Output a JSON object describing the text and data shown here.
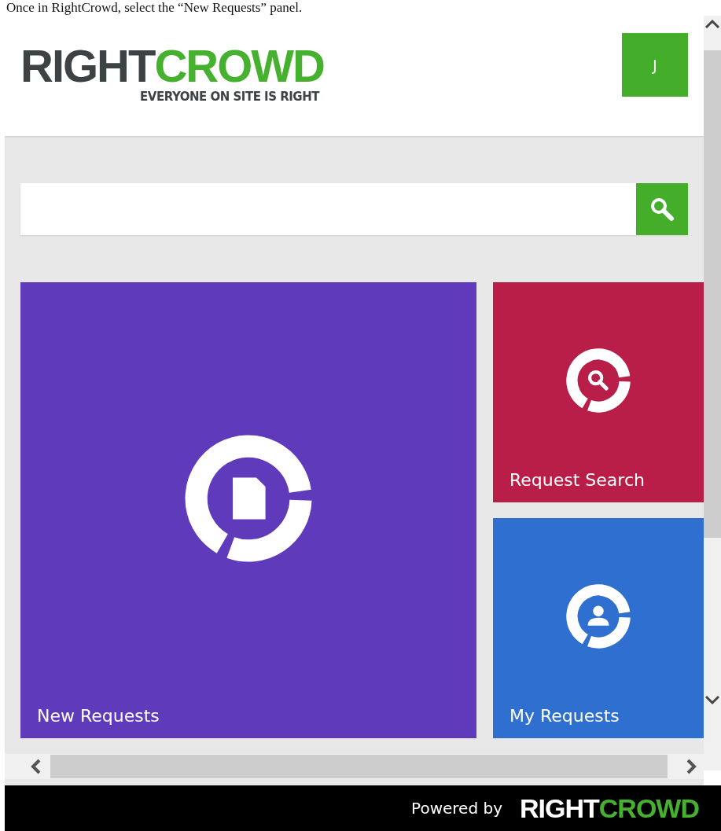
{
  "caption": "Once in RightCrowd, select the “New Requests” panel.",
  "header": {
    "logo": {
      "word_left": "RIGHT",
      "word_right": "CROWD",
      "tagline": "EVERYONE ON SITE IS RIGHT"
    },
    "user_button": "J"
  },
  "tiles": [
    {
      "label": "New Requests",
      "kind": "document",
      "color": "#5f3bbb"
    },
    {
      "label": "Request Search",
      "kind": "search",
      "color": "#b81e48"
    },
    {
      "label": "My Requests",
      "kind": "person",
      "color": "#2e6fd0"
    }
  ],
  "footer": {
    "powered_by": "Powered by",
    "word_left": "RIGHT",
    "word_right": "CROWD"
  }
}
